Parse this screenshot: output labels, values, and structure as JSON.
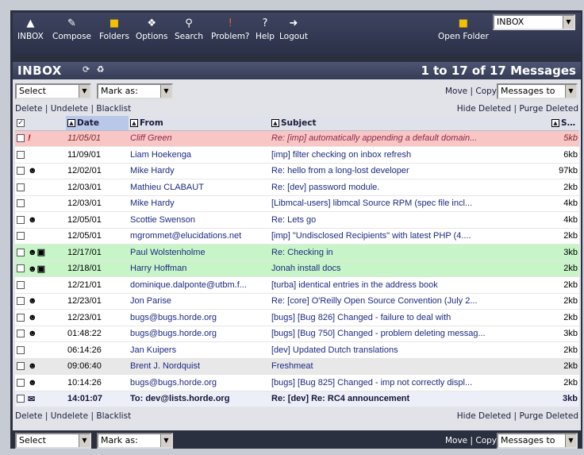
{
  "toolbar": {
    "items": [
      {
        "label": "INBOX",
        "icon": "inbox-icon"
      },
      {
        "label": "Compose",
        "icon": "compose-icon"
      },
      {
        "label": "Folders",
        "icon": "folders-icon"
      },
      {
        "label": "Options",
        "icon": "options-icon"
      },
      {
        "label": "Search",
        "icon": "search-icon"
      },
      {
        "label": "Problem?",
        "icon": "problem-icon"
      },
      {
        "label": "Help",
        "icon": "help-icon"
      },
      {
        "label": "Logout",
        "icon": "logout-icon"
      }
    ],
    "open_folder_label": "Open Folder",
    "folder_value": "INBOX"
  },
  "header": {
    "title": "INBOX",
    "count": "1 to 17 of 17 Messages"
  },
  "controls": {
    "select_value": "Select",
    "mark_value": "Mark as:",
    "move_label": "Move",
    "copy_label": "Copy",
    "target_value": "Messages to"
  },
  "actions": {
    "delete": "Delete",
    "undelete": "Undelete",
    "blacklist": "Blacklist",
    "hide_deleted": "Hide Deleted",
    "purge_deleted": "Purge Deleted"
  },
  "columns": {
    "date": "Date",
    "from": "From",
    "subject": "Subject",
    "size": "Size"
  },
  "messages": [
    {
      "date": "11/05/01",
      "from": "Cliff Green",
      "subject": "Re: [imp] automatically appending a default domain...",
      "size": "5kb",
      "state": "deleted",
      "status": "!"
    },
    {
      "date": "11/09/01",
      "from": "Liam Hoekenga",
      "subject": "[imp] filter checking on inbox refresh",
      "size": "6kb",
      "state": "",
      "status": ""
    },
    {
      "date": "12/02/01",
      "from": "Mike Hardy",
      "subject": "Re: hello from a long-lost developer",
      "size": "97kb",
      "state": "",
      "status": "person"
    },
    {
      "date": "12/03/01",
      "from": "Mathieu CLABAUT",
      "subject": "Re: [dev] password module.",
      "size": "2kb",
      "state": "",
      "status": ""
    },
    {
      "date": "12/03/01",
      "from": "Mike Hardy",
      "subject": "[Libmcal-users] libmcal Source RPM (spec file incl...",
      "size": "4kb",
      "state": "",
      "status": ""
    },
    {
      "date": "12/05/01",
      "from": "Scottie Swenson",
      "subject": "Re: Lets go",
      "size": "4kb",
      "state": "",
      "status": "person"
    },
    {
      "date": "12/05/01",
      "from": "mgrommet@elucidations.net",
      "subject": "[imp] \"Undisclosed Recipients\" with latest PHP (4....",
      "size": "2kb",
      "state": "",
      "status": ""
    },
    {
      "date": "12/17/01",
      "from": "Paul Wolstenholme",
      "subject": "Re: Checking in",
      "size": "3kb",
      "state": "flagged",
      "status": "person-reply"
    },
    {
      "date": "12/18/01",
      "from": "Harry Hoffman",
      "subject": "Jonah install docs",
      "size": "2kb",
      "state": "flagged",
      "status": "person-reply"
    },
    {
      "date": "12/21/01",
      "from": "dominique.dalponte@utbm.f...",
      "subject": "[turba] identical entries in the address book",
      "size": "2kb",
      "state": "",
      "status": ""
    },
    {
      "date": "12/23/01",
      "from": "Jon Parise",
      "subject": "Re: [core] O'Reilly Open Source Convention (July 2...",
      "size": "2kb",
      "state": "",
      "status": "person"
    },
    {
      "date": "12/23/01",
      "from": "bugs@bugs.horde.org",
      "subject": "[bugs] [Bug 826] Changed - failure to deal with",
      "size": "2kb",
      "state": "",
      "status": "person"
    },
    {
      "date": "01:48:22",
      "from": "bugs@bugs.horde.org",
      "subject": "[bugs] [Bug 750] Changed - problem deleting messag...",
      "size": "3kb",
      "state": "",
      "status": "person"
    },
    {
      "date": "06:14:26",
      "from": "Jan Kuipers",
      "subject": "[dev] Updated Dutch translations",
      "size": "2kb",
      "state": "",
      "status": ""
    },
    {
      "date": "09:06:40",
      "from": "Brent J. Nordquist",
      "subject": "Freshmeat",
      "size": "2kb",
      "state": "alt",
      "status": "person"
    },
    {
      "date": "10:14:26",
      "from": "bugs@bugs.horde.org",
      "subject": "[bugs] [Bug 825] Changed - imp not correctly displ...",
      "size": "2kb",
      "state": "",
      "status": "person"
    },
    {
      "date": "14:01:07",
      "from": "To: dev@lists.horde.org",
      "subject": "Re: [dev] Re: RC4 announcement",
      "size": "3kb",
      "state": "unseen",
      "status": "envelope"
    }
  ]
}
